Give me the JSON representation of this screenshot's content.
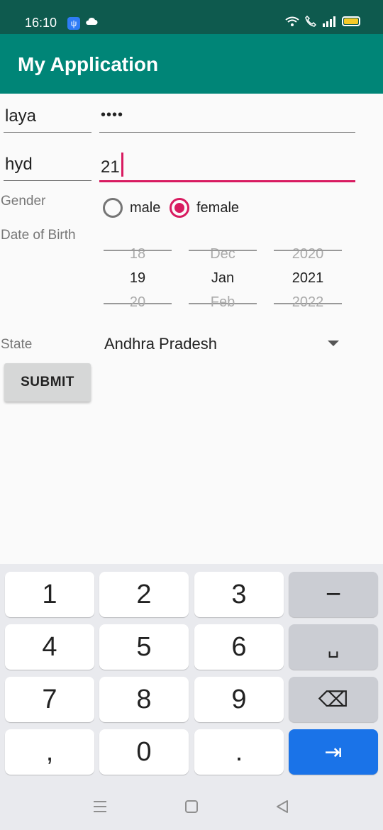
{
  "status_bar": {
    "time": "16:10",
    "usb_icon": "usb-icon",
    "cloud_icon": "cloud-icon"
  },
  "app_bar": {
    "title": "My Application"
  },
  "form": {
    "name_value": "laya",
    "password_value": "••••",
    "city_value": "hyd",
    "age_value": "21",
    "gender_label": "Gender",
    "gender_options": [
      "male",
      "female"
    ],
    "gender_selected": "female",
    "dob_label": "Date of Birth",
    "day": {
      "prev": "18",
      "current": "19",
      "next": "20"
    },
    "month": {
      "prev": "Dec",
      "current": "Jan",
      "next": "Feb"
    },
    "year": {
      "prev": "2020",
      "current": "2021",
      "next": "2022"
    },
    "state_label": "State",
    "state_value": "Andhra Pradesh",
    "submit_label": "SUBMIT"
  },
  "keyboard": {
    "keys": [
      "1",
      "2",
      "3",
      "−",
      "4",
      "5",
      "6",
      "␣",
      "7",
      "8",
      "9",
      "⌫",
      ",",
      "0",
      ".",
      "⇥"
    ]
  },
  "colors": {
    "primary": "#008577",
    "primary_dark": "#0e5a4e",
    "accent": "#d81b60",
    "key_action": "#1a73e8"
  }
}
